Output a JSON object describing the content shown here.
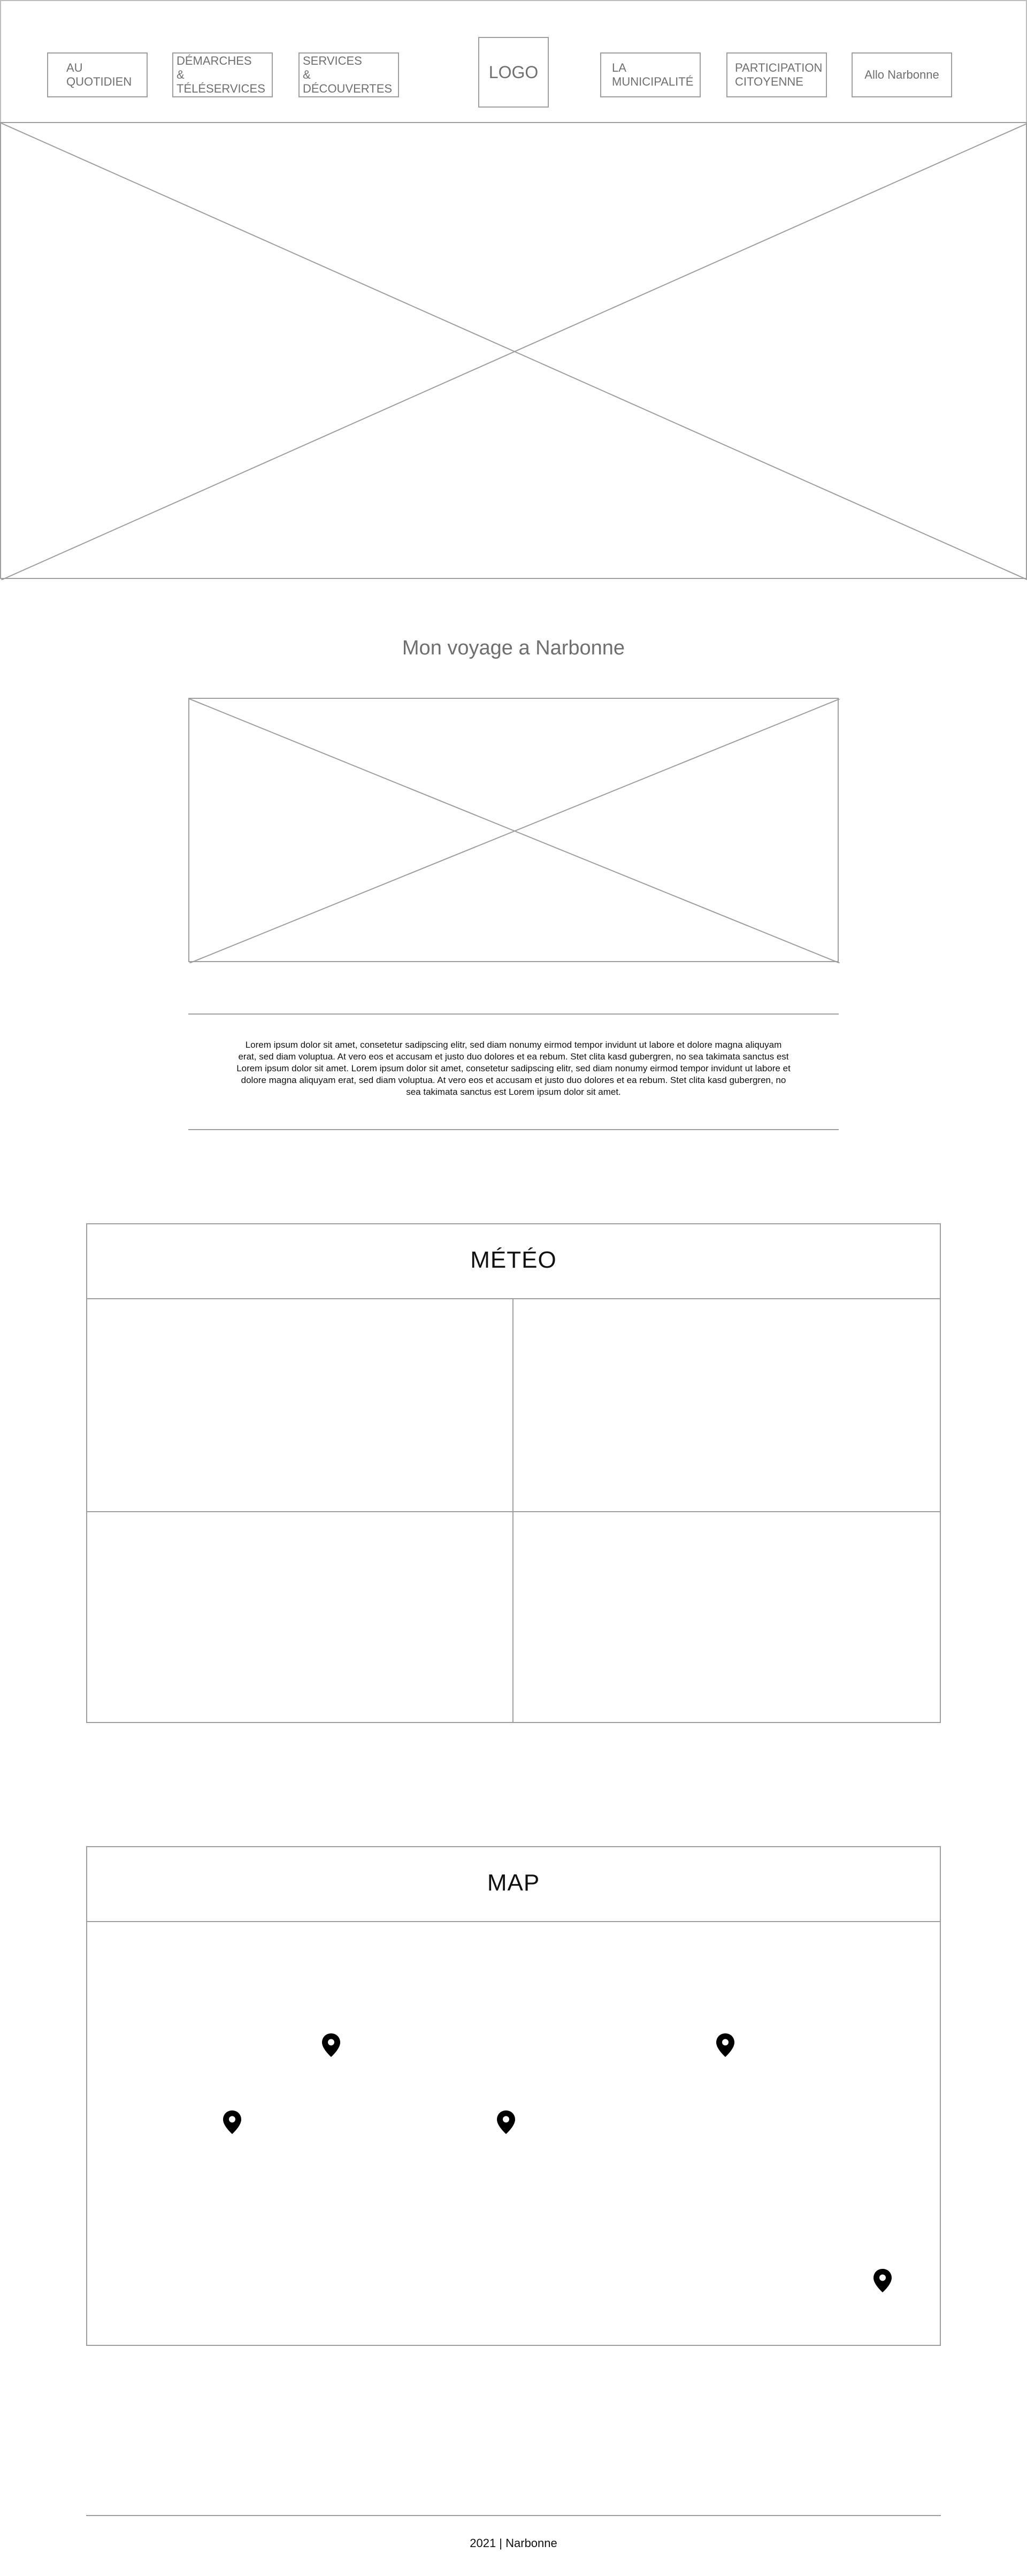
{
  "nav": {
    "left_items": [
      {
        "label": "AU\nQUOTIDIEN"
      },
      {
        "label": "DÉMARCHES\n& TÉLÉSERVICES"
      },
      {
        "label": "SERVICES\n& DÉCOUVERTES"
      }
    ],
    "logo": "LOGO",
    "right_items": [
      {
        "label": "LA\nMUNICIPALITÉ"
      },
      {
        "label": "PARTICIPATION\nCITOYENNE"
      },
      {
        "label": "Allo Narbonne"
      }
    ]
  },
  "voyage": {
    "title": "Mon voyage a Narbonne",
    "text": "Lorem ipsum dolor sit amet, consetetur sadipscing elitr, sed diam nonumy eirmod tempor invidunt ut labore et dolore magna aliquyam erat, sed diam voluptua. At vero eos et accusam et justo duo dolores et ea rebum. Stet clita kasd gubergren, no sea takimata sanctus est Lorem ipsum dolor sit amet. Lorem ipsum dolor sit amet, consetetur sadipscing elitr, sed diam nonumy eirmod tempor invidunt ut labore et dolore magna aliquyam erat, sed diam voluptua. At vero eos et accusam et justo duo dolores et ea rebum. Stet clita kasd gubergren, no sea takimata sanctus est Lorem ipsum dolor sit amet."
  },
  "meteo": {
    "title": "MÉTÉO"
  },
  "map": {
    "title": "MAP",
    "marker_icon": "map-pin-icon",
    "marker_count": 5
  },
  "footer": {
    "text": "2021 | Narbonne"
  }
}
